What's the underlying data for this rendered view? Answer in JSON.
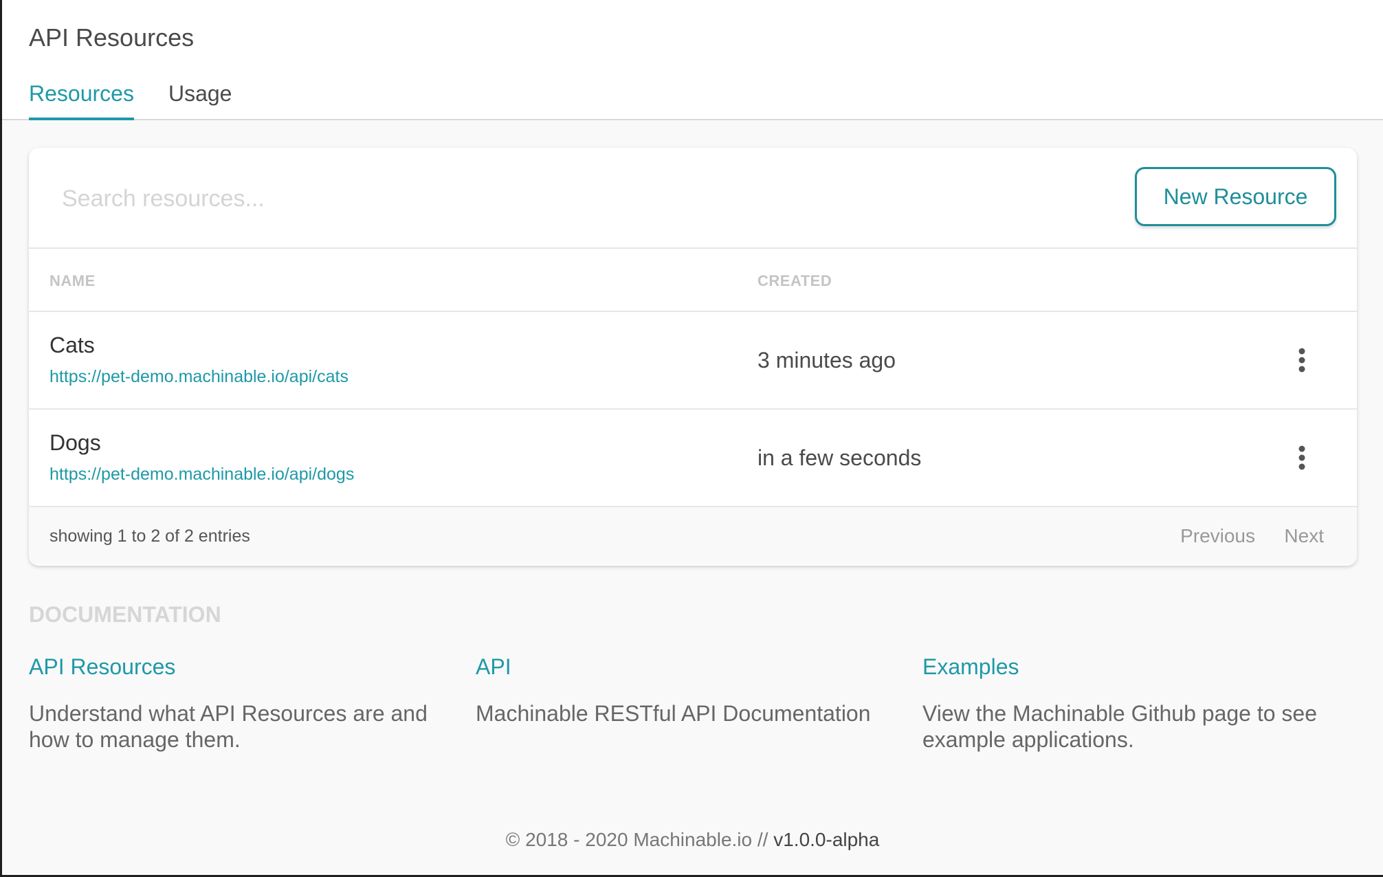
{
  "header": {
    "title": "API Resources",
    "tabs": [
      {
        "label": "Resources",
        "active": true
      },
      {
        "label": "Usage",
        "active": false
      }
    ]
  },
  "resources": {
    "search": {
      "placeholder": "Search resources...",
      "value": ""
    },
    "new_button_label": "New Resource",
    "columns": [
      "NAME",
      "CREATED"
    ],
    "rows": [
      {
        "name": "Cats",
        "url": "https://pet-demo.machinable.io/api/cats",
        "created": "3 minutes ago"
      },
      {
        "name": "Dogs",
        "url": "https://pet-demo.machinable.io/api/dogs",
        "created": "in a few seconds"
      }
    ],
    "row_menu_icon": "more-vertical-icon",
    "footer": {
      "entries_text": "showing 1 to 2 of 2 entries",
      "previous_label": "Previous",
      "next_label": "Next"
    }
  },
  "documentation": {
    "heading": "DOCUMENTATION",
    "items": [
      {
        "title": "API Resources",
        "description": "Understand what API Resources are and how to manage them."
      },
      {
        "title": "API",
        "description": "Machinable RESTful API Documentation"
      },
      {
        "title": "Examples",
        "description": "View the Machinable Github page to see example applications."
      }
    ]
  },
  "footer": {
    "copyright": "© 2018 - 2020 Machinable.io // ",
    "version": "v1.0.0-alpha"
  },
  "colors": {
    "accent": "#1e99a7",
    "page_background": "#f9f9f9"
  }
}
